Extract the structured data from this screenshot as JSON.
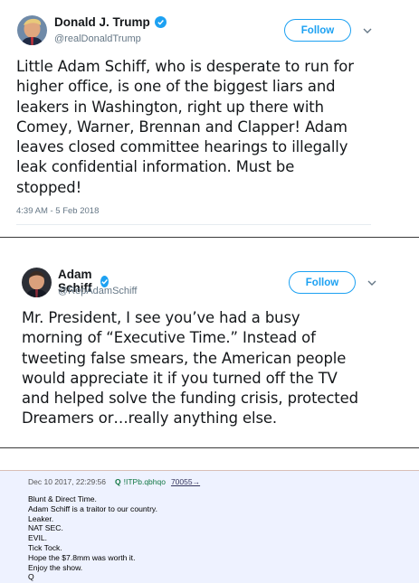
{
  "tweets": [
    {
      "display_name": "Donald J. Trump",
      "handle": "@realDonaldTrump",
      "follow_label": "Follow",
      "text_lines": [
        "Little Adam Schiff, who is desperate to run for",
        "higher office, is one of the biggest liars and",
        "leakers in Washington, right up there with",
        "Comey, Warner, Brennan and Clapper! Adam",
        "leaves closed committee hearings to illegally",
        "leak confidential information. Must be",
        "stopped!"
      ],
      "timestamp": "4:39 AM - 5 Feb 2018"
    },
    {
      "display_name": "Adam Schiff",
      "handle": "@RepAdamSchiff",
      "follow_label": "Follow",
      "text_lines": [
        "Mr. President, I see you’ve had a busy",
        "morning of “Executive Time.” Instead of",
        "tweeting false smears, the American people",
        "would appreciate it if you turned off the TV",
        "and helped solve the funding crisis, protected",
        "Dreamers or…really anything else."
      ]
    }
  ],
  "q_post": {
    "date": "Dec 10 2017, 22:29:56",
    "name": "Q",
    "tripcode": "!ITPb.qbhqo",
    "post_id": "70055→",
    "lines": [
      "Blunt & Direct Time.",
      "Adam Schiff is a traitor to our country.",
      "Leaker.",
      "NAT SEC.",
      "EVIL.",
      "Tick Tock.",
      "Hope the $7.8mm was worth it.",
      "Enjoy the show.",
      "Q"
    ]
  },
  "colors": {
    "twitter_blue": "#1da1f2",
    "q_name_green": "#117743",
    "q_background": "#eef2ff"
  },
  "icons": [
    "verified-badge-icon",
    "chevron-down-icon",
    "avatar"
  ]
}
